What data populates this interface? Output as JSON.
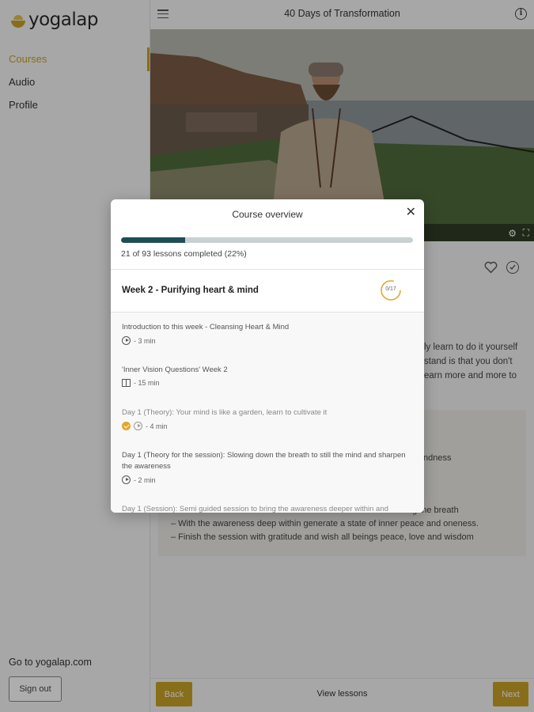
{
  "brand": {
    "logo_text": "yogalap",
    "accent_color": "#c9a227"
  },
  "sidebar": {
    "items": [
      {
        "label": "Courses",
        "active": true
      },
      {
        "label": "Audio",
        "active": false
      },
      {
        "label": "Profile",
        "active": false
      }
    ],
    "goto_link": "Go to yogalap.com",
    "signout_label": "Sign out"
  },
  "header": {
    "title": "40 Days of Transformation",
    "menu_icon": "hamburger-icon",
    "info_icon": "info-icon"
  },
  "video": {
    "controls": [
      "settings-gear-icon",
      "fullscreen-icon"
    ]
  },
  "content": {
    "description_visible_fragments": [
      "ly learn to do it yourself",
      "stand is that you don't",
      "earn more and more to"
    ],
    "box_fragment": "ndness",
    "box_fragment2": "g the breath",
    "box_lines": [
      "– With the awareness deep within generate a state of inner peace and oneness.",
      "– Finish the session with gratitude and wish all beings peace, love and wisdom"
    ]
  },
  "bottom_bar": {
    "back_label": "Back",
    "view_lessons_label": "View lessons",
    "next_label": "Next"
  },
  "modal": {
    "title": "Course overview",
    "progress": {
      "fraction": 0.22,
      "text": "21 of 93 lessons completed (22%)"
    },
    "week": {
      "title": "Week 2 - Purifying heart & mind",
      "progress_text": "0/17",
      "progress_fraction": 0.0
    },
    "lessons": [
      {
        "title": "Introduction to this week - Cleansing Heart & Mind",
        "type_icon": "play-icon",
        "duration": "- 3 min",
        "completed": false
      },
      {
        "title": "'Inner Vision Questions' Week 2",
        "type_icon": "book-icon",
        "duration": "- 15 min",
        "completed": false
      },
      {
        "title": "Day 1 (Theory): Your mind is like a garden, learn to cultivate it",
        "type_icon": "play-icon",
        "duration": "- 4 min",
        "completed": true
      },
      {
        "title": "Day 1 (Theory for the session): Slowing down the breath to still the mind and sharpen the awareness",
        "type_icon": "play-icon",
        "duration": "- 2 min",
        "completed": false
      },
      {
        "title": "Day 1 (Session): Semi guided session to bring the awareness deeper within and",
        "type_icon": "play-icon",
        "duration": "",
        "completed": false
      }
    ]
  }
}
